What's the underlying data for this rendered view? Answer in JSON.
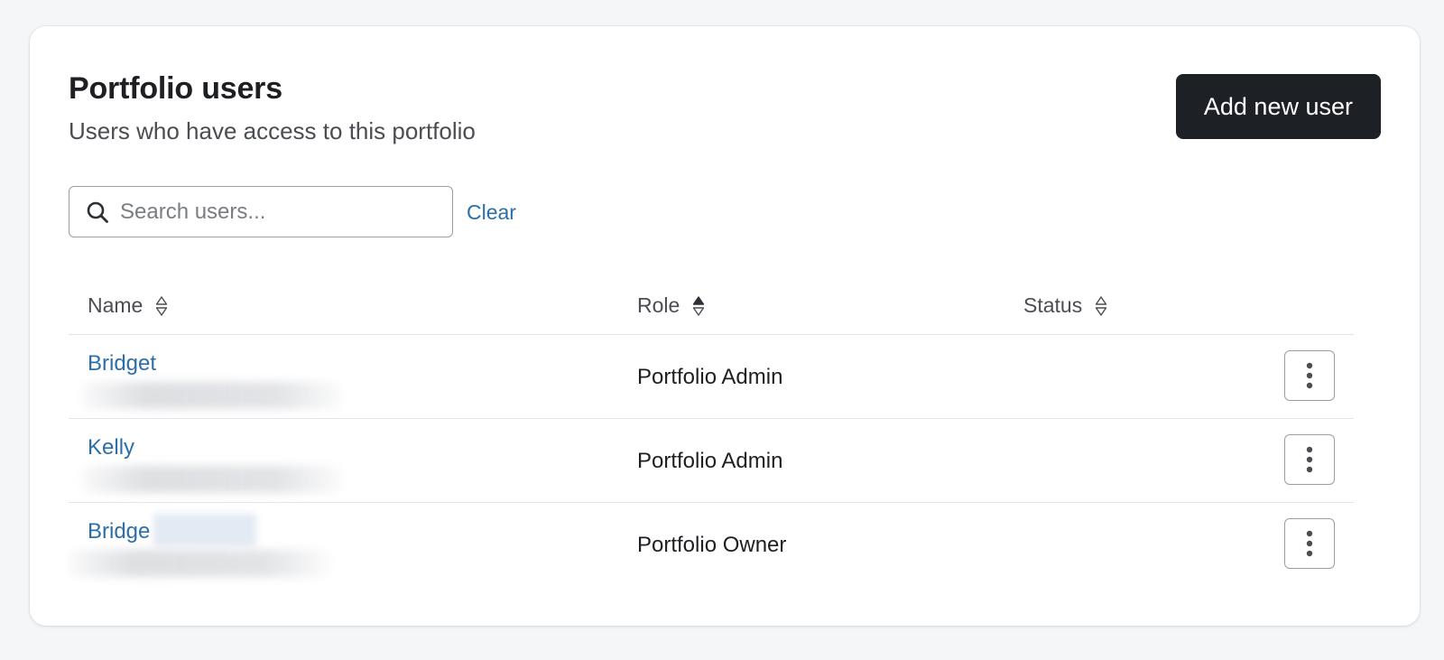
{
  "header": {
    "title": "Portfolio users",
    "subtitle": "Users who have access to this portfolio",
    "add_button_label": "Add new user"
  },
  "search": {
    "placeholder": "Search users...",
    "value": "",
    "clear_label": "Clear"
  },
  "table": {
    "columns": [
      {
        "label": "Name",
        "sort": "none"
      },
      {
        "label": "Role",
        "sort": "ascending"
      },
      {
        "label": "Status",
        "sort": "none"
      }
    ],
    "rows": [
      {
        "name": "Bridget",
        "role": "Portfolio Admin",
        "status": ""
      },
      {
        "name": "Kelly",
        "role": "Portfolio Admin",
        "status": ""
      },
      {
        "name": "Bridge",
        "role": "Portfolio Owner",
        "status": ""
      }
    ]
  },
  "icons": {
    "search": "search-icon",
    "sort": "sort-icon",
    "row_menu": "more-vertical-icon"
  },
  "colors": {
    "link": "#2b6ea8",
    "primary_button": "#1d2024",
    "text": "#1d1f22"
  }
}
